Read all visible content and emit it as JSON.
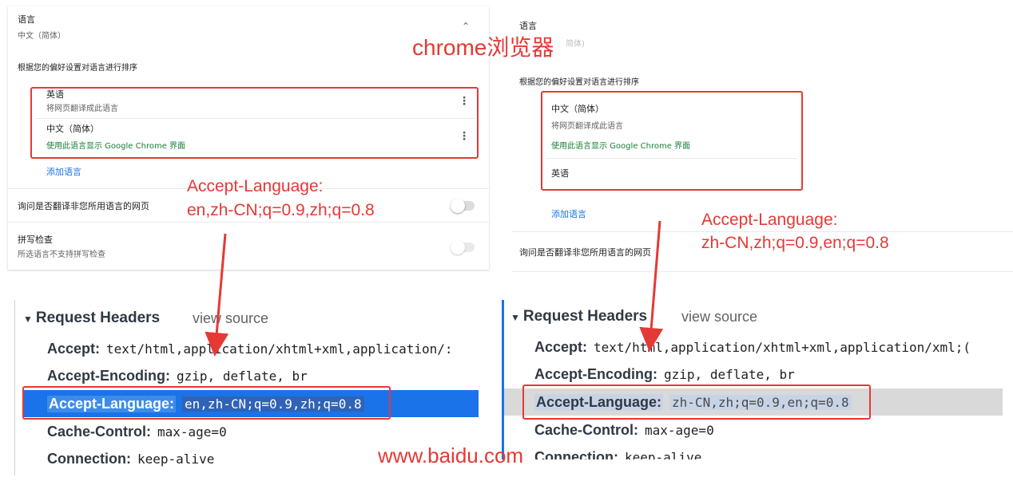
{
  "left_settings": {
    "language_label": "语言",
    "language_value": "中文（简体）",
    "sort_hint": "根据您的偏好设置对语言进行排序",
    "lang_items": [
      {
        "name": "英语",
        "desc": "将网页翻译成此语言"
      },
      {
        "name": "中文（简体）",
        "desc": "使用此语言显示 Google Chrome 界面"
      }
    ],
    "add_language": "添加语言",
    "translate_prompt": "询问是否翻译非您所用语言的网页",
    "spellcheck_title": "拼写检查",
    "spellcheck_desc": "所选语言不支持拼写检查"
  },
  "right_settings": {
    "language_label": "语言",
    "language_value_partial": "简体)",
    "sort_hint": "根据您的偏好设置对语言进行排序",
    "lang_items": [
      {
        "name": "中文（简体）",
        "desc": "将网页翻译成此语言",
        "desc2": "使用此语言显示 Google Chrome 界面"
      },
      {
        "name": "英语"
      }
    ],
    "add_language": "添加语言",
    "translate_prompt": "询问是否翻译非您所用语言的网页"
  },
  "annotations": {
    "browser_label": "chrome浏览器",
    "left_accept_label": "Accept-Language:",
    "left_accept_value": "en,zh-CN;q=0.9,zh;q=0.8",
    "right_accept_label": "Accept-Language:",
    "right_accept_value": "zh-CN,zh;q=0.9,en;q=0.8",
    "watermark": "www.baidu.com",
    "color": "#e53935"
  },
  "devtools_left": {
    "section_title": "Request Headers",
    "view_source": "view source",
    "headers": [
      {
        "key": "Accept:",
        "value": "text/html,application/xhtml+xml,application/:"
      },
      {
        "key": "Accept-Encoding:",
        "value": "gzip, deflate, br"
      },
      {
        "key": "Accept-Language:",
        "value": "en,zh-CN;q=0.9,zh;q=0.8",
        "selected": true
      },
      {
        "key": "Cache-Control:",
        "value": "max-age=0"
      },
      {
        "key": "Connection:",
        "value": "keep-alive"
      }
    ]
  },
  "devtools_right": {
    "section_title": "Request Headers",
    "view_source": "view source",
    "headers": [
      {
        "key": "Accept:",
        "value": "text/html,application/xhtml+xml,application/xml;("
      },
      {
        "key": "Accept-Encoding:",
        "value": "gzip, deflate, br"
      },
      {
        "key": "Accept-Language:",
        "value": "zh-CN,zh;q=0.9,en;q=0.8",
        "selected": true
      },
      {
        "key": "Cache-Control:",
        "value": "max-age=0"
      },
      {
        "key": "Connection:",
        "value": "keep-alive"
      }
    ]
  },
  "colors": {
    "accent_blue": "#1a73e8",
    "green_text": "#188038",
    "selection_grey": "#d9d9d9"
  }
}
